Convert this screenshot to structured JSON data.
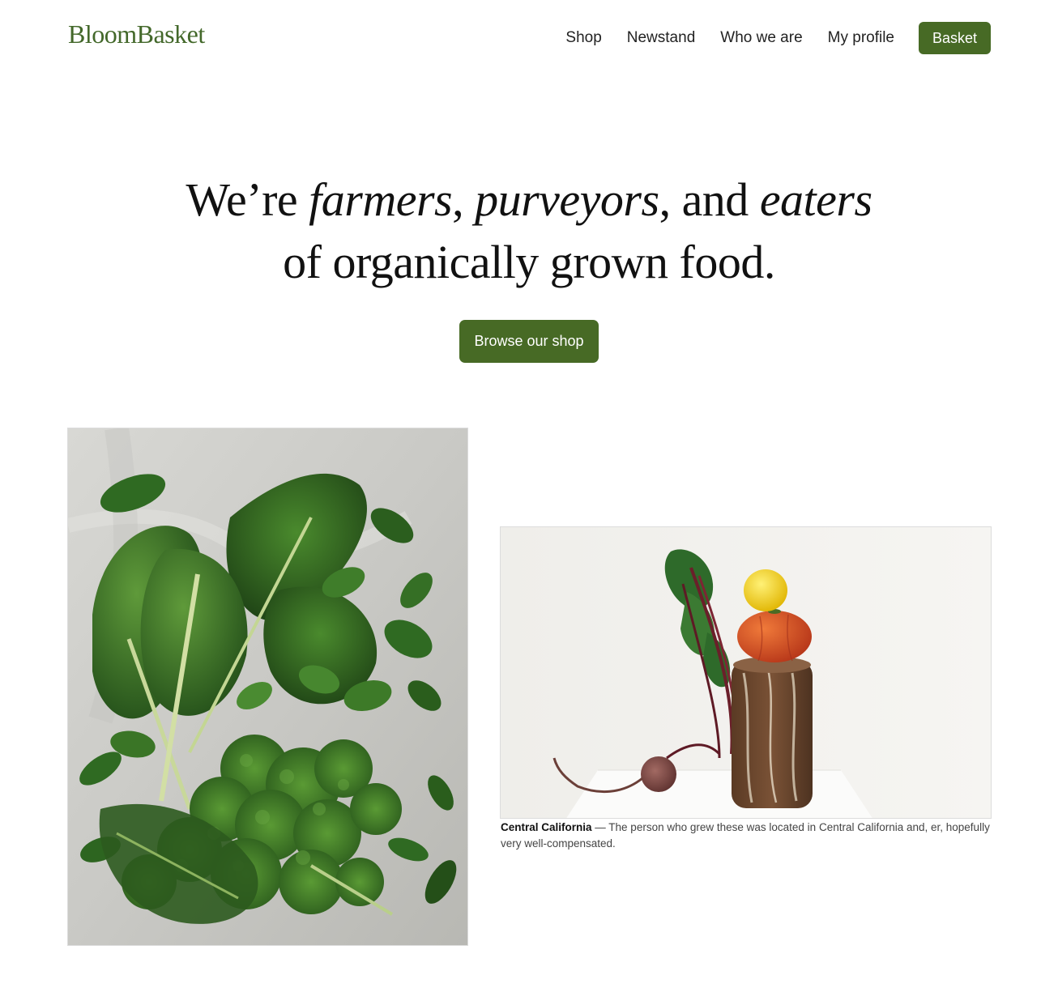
{
  "brand": {
    "logo_text": "BloomBasket",
    "accent_color": "#476a25"
  },
  "nav": {
    "items": [
      "Shop",
      "Newstand",
      "Who we are",
      "My profile"
    ],
    "basket_label": "Basket"
  },
  "hero": {
    "line1": {
      "lead": "We’re ",
      "word1": "farmers",
      "sep1": ", ",
      "word2": "purveyors",
      "sep2": ", and ",
      "word3": "eaters"
    },
    "line2": "of organically grown food.",
    "cta_label": "Browse our shop"
  },
  "photos": {
    "left_subject": "leafy greens: chard, spinach and kale on grey stone",
    "right_subject": "beet, bread loaf, tomato and lemon stacked on white table",
    "caption_title": "Central California",
    "caption_dash": " — ",
    "caption_text": "The person who grew these was located in Central California and, er, hopefully very well-compensated."
  }
}
